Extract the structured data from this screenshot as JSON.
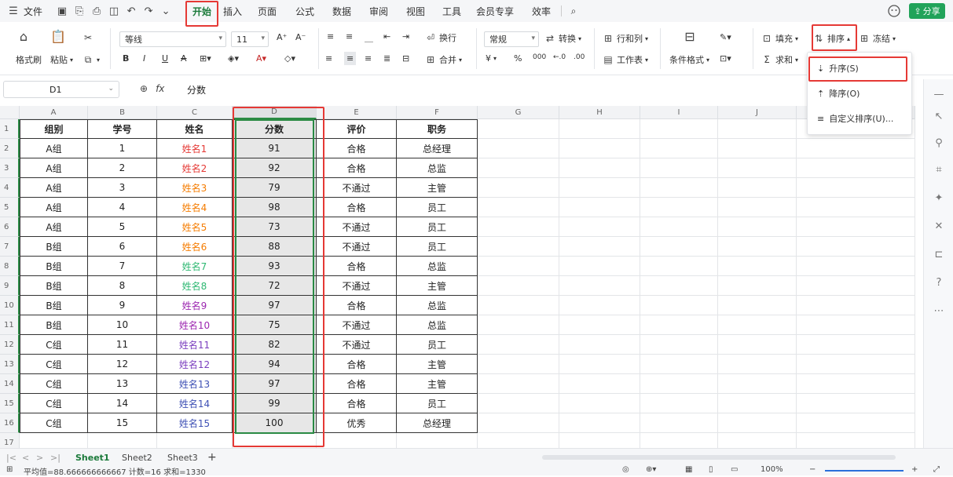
{
  "menubar": {
    "file_label": "文件",
    "tabs": [
      "开始",
      "插入",
      "页面",
      "公式",
      "数据",
      "审阅",
      "视图",
      "工具",
      "会员专享",
      "效率"
    ],
    "active_tab": "开始",
    "share_label": "分享"
  },
  "ribbon": {
    "format_painter": "格式刷",
    "paste": "粘贴",
    "font_name": "等线",
    "font_size": "11",
    "wrap": "换行",
    "merge": "合并",
    "number_format": "常规",
    "convert": "转换",
    "rows_cols": "行和列",
    "worksheet": "工作表",
    "cond_format": "条件格式",
    "fill": "填充",
    "sum": "求和",
    "sort": "排序",
    "freeze": "冻结",
    "currency": "¥",
    "percent": "%",
    "thousands": "000",
    "dec_inc": "←.0",
    "dec_dec": ".00"
  },
  "formula": {
    "cell_ref": "D1",
    "value": "分数"
  },
  "columns": [
    "A",
    "B",
    "C",
    "D",
    "E",
    "F",
    "G",
    "H",
    "I",
    "J"
  ],
  "table": {
    "headers": [
      "组别",
      "学号",
      "姓名",
      "分数",
      "评价",
      "职务"
    ],
    "rows": [
      [
        "A组",
        "1",
        "姓名1",
        "91",
        "合格",
        "总经理"
      ],
      [
        "A组",
        "2",
        "姓名2",
        "92",
        "合格",
        "总监"
      ],
      [
        "A组",
        "3",
        "姓名3",
        "79",
        "不通过",
        "主管"
      ],
      [
        "A组",
        "4",
        "姓名4",
        "98",
        "合格",
        "员工"
      ],
      [
        "A组",
        "5",
        "姓名5",
        "73",
        "不通过",
        "员工"
      ],
      [
        "B组",
        "6",
        "姓名6",
        "88",
        "不通过",
        "员工"
      ],
      [
        "B组",
        "7",
        "姓名7",
        "93",
        "合格",
        "总监"
      ],
      [
        "B组",
        "8",
        "姓名8",
        "72",
        "不通过",
        "主管"
      ],
      [
        "B组",
        "9",
        "姓名9",
        "97",
        "合格",
        "总监"
      ],
      [
        "B组",
        "10",
        "姓名10",
        "75",
        "不通过",
        "总监"
      ],
      [
        "C组",
        "11",
        "姓名11",
        "82",
        "不通过",
        "员工"
      ],
      [
        "C组",
        "12",
        "姓名12",
        "94",
        "合格",
        "主管"
      ],
      [
        "C组",
        "13",
        "姓名13",
        "97",
        "合格",
        "主管"
      ],
      [
        "C组",
        "14",
        "姓名14",
        "99",
        "合格",
        "员工"
      ],
      [
        "C组",
        "15",
        "姓名15",
        "100",
        "优秀",
        "总经理"
      ]
    ],
    "name_colors": [
      "#e53935",
      "#e53935",
      "#f57c00",
      "#f57c00",
      "#f57c00",
      "#f57c00",
      "#2eb872",
      "#2eb872",
      "#9c27b0",
      "#9c27b0",
      "#7b3fbf",
      "#7b3fbf",
      "#3f51b5",
      "#3f51b5",
      "#3f51b5"
    ]
  },
  "row_numbers": [
    "1",
    "2",
    "3",
    "4",
    "5",
    "6",
    "7",
    "8",
    "9",
    "10",
    "11",
    "12",
    "13",
    "14",
    "15",
    "16",
    "17"
  ],
  "sort_menu": {
    "ascending": "升序(S)",
    "descending": "降序(O)",
    "custom": "自定义排序(U)..."
  },
  "sheets": [
    "Sheet1",
    "Sheet2",
    "Sheet3"
  ],
  "active_sheet": "Sheet1",
  "status": {
    "summary": "平均值=88.666666666667  计数=16  求和=1330",
    "zoom": "100%"
  }
}
